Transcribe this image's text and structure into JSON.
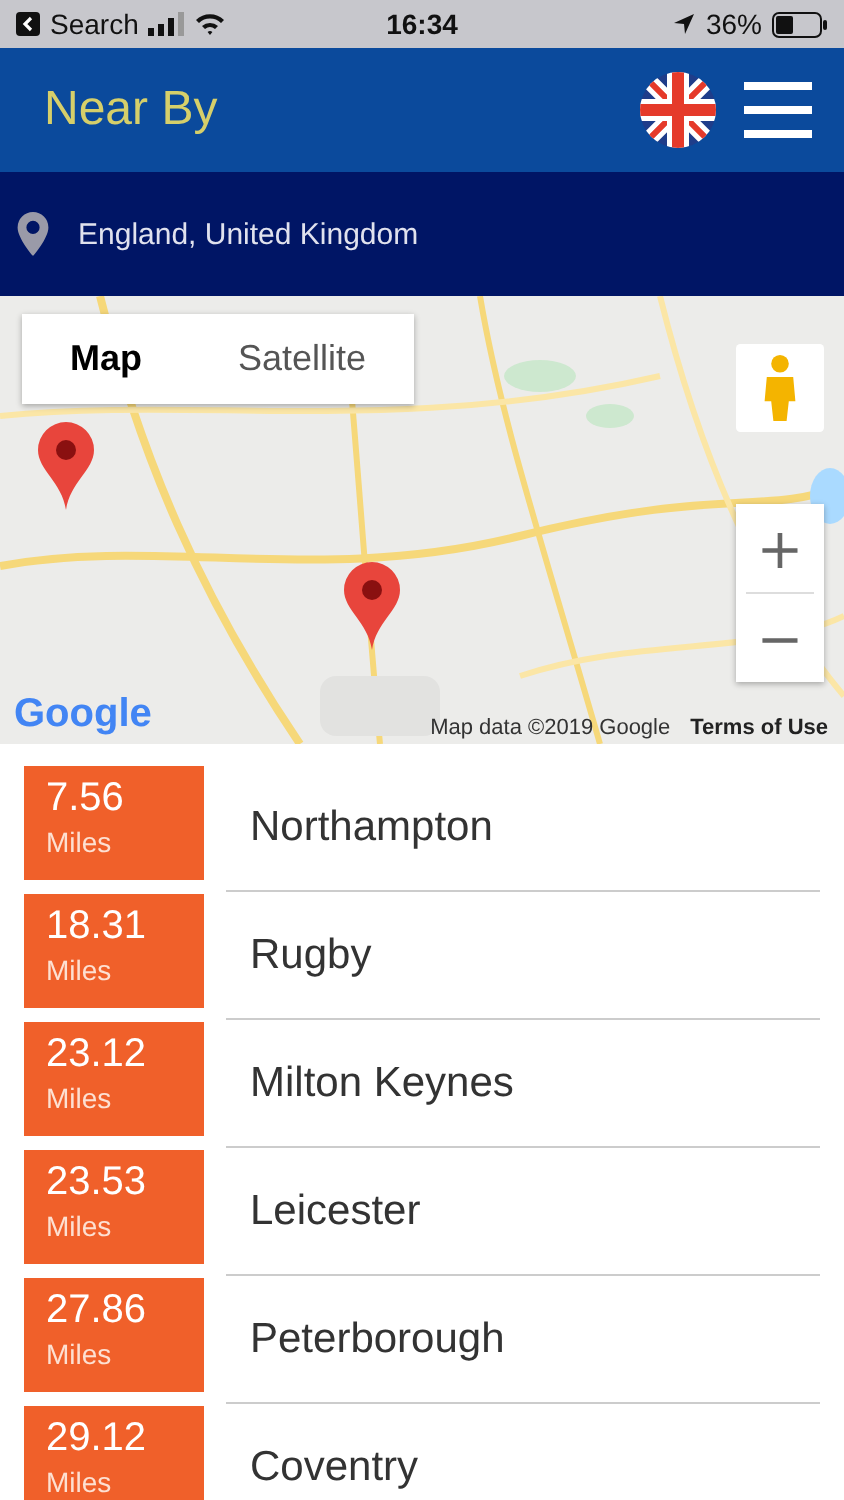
{
  "status_bar": {
    "back_label": "Search",
    "time": "16:34",
    "battery_percent": "36%"
  },
  "header": {
    "title": "Near By"
  },
  "location": {
    "text": "England, United Kingdom"
  },
  "map": {
    "kind": "picture",
    "map_types": [
      {
        "label": "Map",
        "selected": true
      },
      {
        "label": "Satellite",
        "selected": false
      }
    ],
    "zoom_in": "+",
    "zoom_out": "−",
    "logo": "Google",
    "attribution": "Map data ©2019 Google",
    "terms": "Terms of Use"
  },
  "places": [
    {
      "distance": "7.56",
      "unit": "Miles",
      "name": "Northampton"
    },
    {
      "distance": "18.31",
      "unit": "Miles",
      "name": "Rugby"
    },
    {
      "distance": "23.12",
      "unit": "Miles",
      "name": "Milton Keynes"
    },
    {
      "distance": "23.53",
      "unit": "Miles",
      "name": "Leicester"
    },
    {
      "distance": "27.86",
      "unit": "Miles",
      "name": "Peterborough"
    },
    {
      "distance": "29.12",
      "unit": "Miles",
      "name": "Coventry"
    }
  ]
}
